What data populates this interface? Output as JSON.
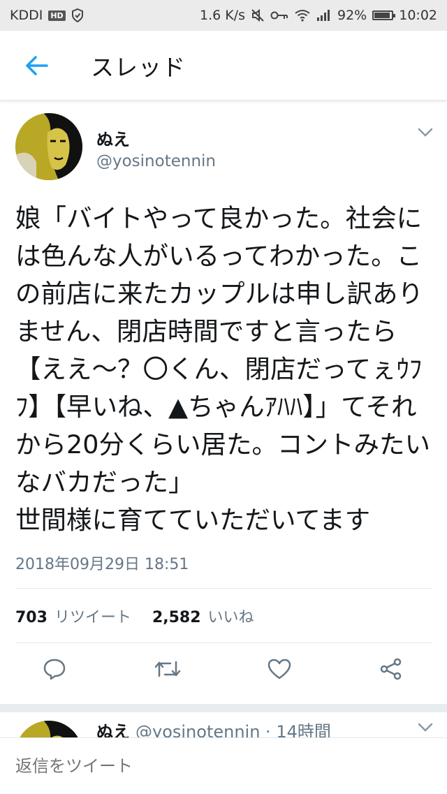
{
  "statusbar": {
    "carrier": "KDDI",
    "hd_badge": "HD",
    "speed": "1.6 K/s",
    "battery_pct": "92%",
    "time": "10:02"
  },
  "header": {
    "title": "スレッド"
  },
  "tweet": {
    "name": "ぬえ",
    "handle": "@yosinotennin",
    "text": "娘「バイトやって良かった。社会には色んな人がいるってわかった。この前店に来たカップルは申し訳ありません、閉店時間ですと言ったら【ええ～？〇くん、閉店だってぇｳﾌﾌ】【早いね、▲ちゃんｱﾊﾊ】」てそれから20分くらい居た。コントみたいなバカだった」\n世間様に育てていただいてます",
    "timestamp": "2018年09月29日 18:51",
    "retweet_count": "703",
    "retweet_label": "リツイート",
    "like_count": "2,582",
    "like_label": "いいね"
  },
  "next_tweet": {
    "name": "ぬえ",
    "handle_time": "@yosinotennin · 14時間"
  },
  "reply": {
    "placeholder": "返信をツイート"
  },
  "colors": {
    "accent": "#1da1f2",
    "text": "#14171a",
    "secondary": "#657786"
  }
}
